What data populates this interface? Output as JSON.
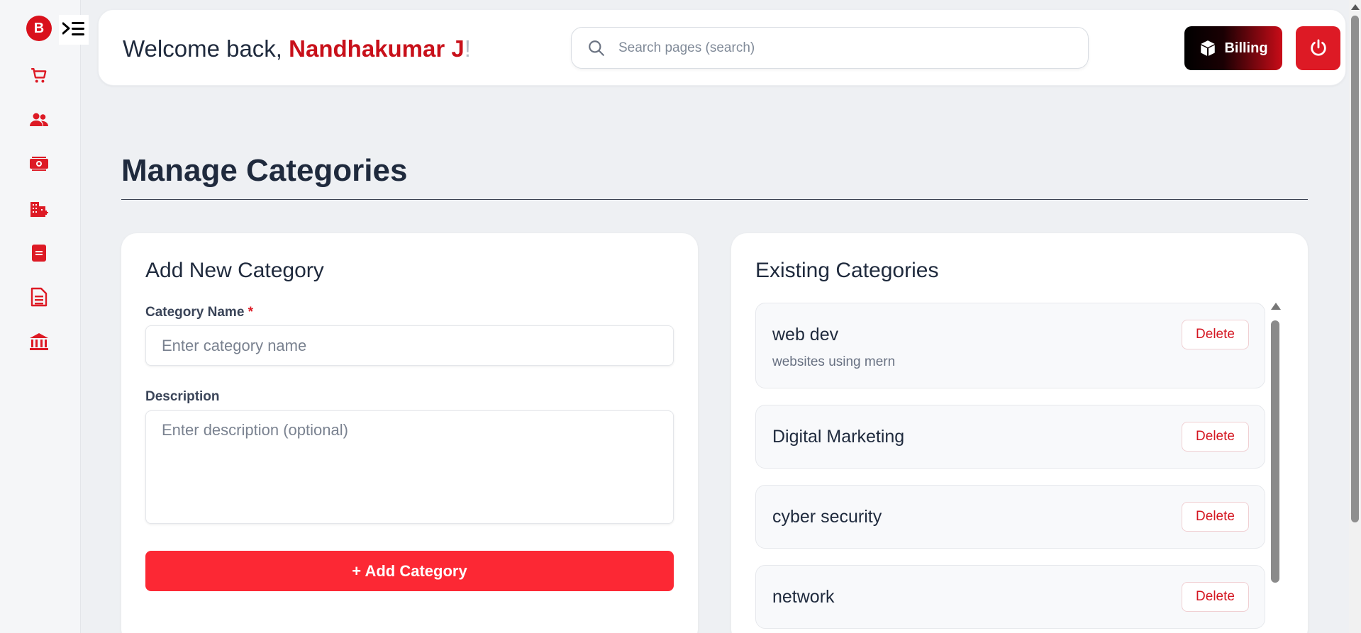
{
  "sidebar": {
    "logo_letter": "B",
    "nav": [
      "cart-icon",
      "users-icon",
      "money-icon",
      "building-add-icon",
      "document-icon",
      "report-icon",
      "bank-icon"
    ],
    "accent": "#dd1a25"
  },
  "header": {
    "welcome_prefix": "Welcome back, ",
    "user_name": "Nandhakumar J",
    "welcome_suffix": "!",
    "search_placeholder": "Search pages (search)",
    "billing_label": "Billing"
  },
  "page": {
    "title": "Manage Categories"
  },
  "add_form": {
    "title": "Add New Category",
    "name_label": "Category Name",
    "required_mark": "*",
    "name_placeholder": "Enter category name",
    "desc_label": "Description",
    "desc_placeholder": "Enter description (optional)",
    "submit_label": "+ Add Category"
  },
  "existing": {
    "title": "Existing Categories",
    "delete_label": "Delete",
    "items": [
      {
        "name": "web dev",
        "description": "websites using mern"
      },
      {
        "name": "Digital Marketing",
        "description": ""
      },
      {
        "name": "cyber security",
        "description": ""
      },
      {
        "name": "network",
        "description": ""
      }
    ]
  }
}
